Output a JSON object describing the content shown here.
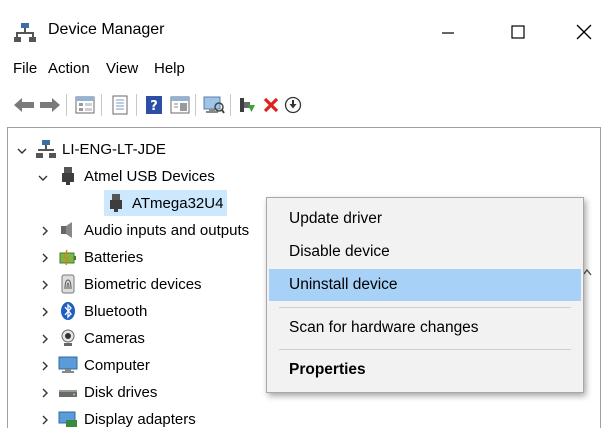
{
  "window": {
    "title": "Device Manager",
    "controls": {
      "minimize": "minimize",
      "maximize": "maximize",
      "close": "close"
    }
  },
  "menubar": {
    "items": [
      "File",
      "Action",
      "View",
      "Help"
    ]
  },
  "toolbar": {
    "icons": [
      "back-arrow-icon",
      "forward-arrow-icon",
      "properties-grid-icon",
      "device-list-icon",
      "help-icon",
      "details-pane-icon",
      "scan-monitor-icon",
      "update-driver-icon",
      "uninstall-x-icon",
      "download-circle-icon"
    ]
  },
  "tree": {
    "root": "LI-ENG-LT-JDE",
    "atmel": "Atmel USB Devices",
    "atmega": "ATmega32U4",
    "nodes": [
      "Audio inputs and outputs",
      "Batteries",
      "Biometric devices",
      "Bluetooth",
      "Cameras",
      "Computer",
      "Disk drives",
      "Display adapters"
    ]
  },
  "context_menu": {
    "items": [
      {
        "label": "Update driver"
      },
      {
        "label": "Disable device"
      },
      {
        "label": "Uninstall device",
        "highlighted": true
      },
      {
        "label": "Scan for hardware changes"
      },
      {
        "label": "Properties",
        "bold": true
      }
    ]
  },
  "colors": {
    "selection": "#cce8ff",
    "menu_highlight": "#a7d1f7",
    "menu_bg": "#f2f2f2"
  }
}
